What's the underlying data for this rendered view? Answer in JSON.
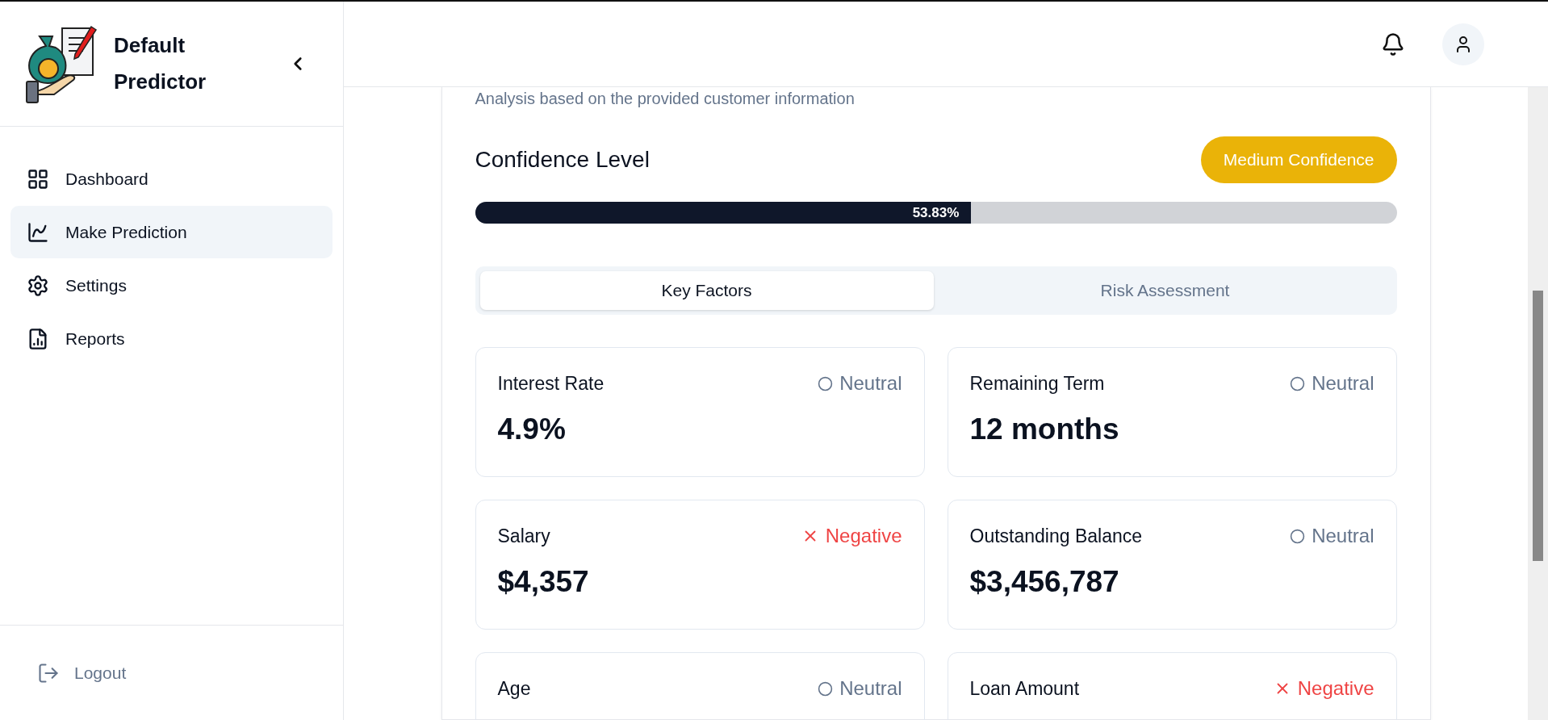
{
  "sidebar": {
    "title": "Default Predictor",
    "items": [
      {
        "label": "Dashboard",
        "selected": false
      },
      {
        "label": "Make Prediction",
        "selected": true
      },
      {
        "label": "Settings",
        "selected": false
      },
      {
        "label": "Reports",
        "selected": false
      }
    ],
    "logout": "Logout"
  },
  "result": {
    "subtitle": "Analysis based on the provided customer information",
    "confidence_title": "Confidence Level",
    "badge": "Medium Confidence",
    "level": 0.5383,
    "reading": "53.83%",
    "tabs": [
      {
        "label": "Key Factors",
        "selected": true
      },
      {
        "label": "Risk Assessment",
        "selected": false
      }
    ],
    "factors": [
      {
        "label": "Interest Rate",
        "kind": "neutral",
        "impact": "Neutral",
        "value": "4.9%"
      },
      {
        "label": "Remaining Term",
        "kind": "neutral",
        "impact": "Neutral",
        "value": "12 months"
      },
      {
        "label": "Salary",
        "kind": "negative",
        "impact": "Negative",
        "value": "$4,357"
      },
      {
        "label": "Outstanding Balance",
        "kind": "neutral",
        "impact": "Neutral",
        "value": "$3,456,787"
      },
      {
        "label": "Age",
        "kind": "neutral",
        "impact": "Neutral"
      },
      {
        "label": "Loan Amount",
        "kind": "negative",
        "impact": "Negative"
      }
    ]
  }
}
